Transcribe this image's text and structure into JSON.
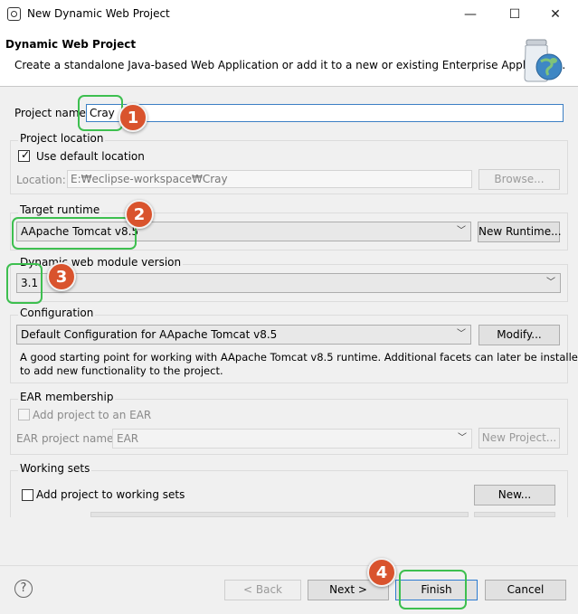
{
  "window": {
    "title": "New Dynamic Web Project",
    "minimize": "—",
    "maximize": "☐",
    "close": "✕"
  },
  "header": {
    "title": "Dynamic Web Project",
    "description": "Create a standalone Java-based Web Application or add it to a new or existing Enterprise Application."
  },
  "project_name": {
    "label": "Project name:",
    "value": "Cray"
  },
  "project_location": {
    "group_label": "Project location",
    "use_default_label": "Use default location",
    "use_default_checked": true,
    "location_label": "Location:",
    "location_value": "E:₩eclipse-workspace₩Cray",
    "browse_label": "Browse..."
  },
  "target_runtime": {
    "group_label": "Target runtime",
    "selected": "AApache Tomcat v8.5",
    "new_runtime_label": "New Runtime..."
  },
  "module_version": {
    "group_label": "Dynamic web module version",
    "selected": "3.1"
  },
  "configuration": {
    "group_label": "Configuration",
    "selected": "Default Configuration for AApache Tomcat v8.5",
    "modify_label": "Modify...",
    "description_line1": "A good starting point for working with AApache Tomcat v8.5 runtime. Additional facets can later be installed",
    "description_line2": "to add new functionality to the project."
  },
  "ear_membership": {
    "group_label": "EAR membership",
    "add_label": "Add project to an EAR",
    "project_name_label": "EAR project name:",
    "project_name_value": "EAR",
    "new_project_label": "New Project..."
  },
  "working_sets": {
    "group_label": "Working sets",
    "add_label": "Add project to working sets",
    "new_label": "New..."
  },
  "footer": {
    "help_icon": "?",
    "back_label": "< Back",
    "next_label": "Next >",
    "finish_label": "Finish",
    "cancel_label": "Cancel"
  },
  "annotations": {
    "badge1": "1",
    "badge2": "2",
    "badge3": "3",
    "badge4": "4",
    "highlight_color": "#3dbf4f",
    "badge_color": "#d9532d"
  }
}
